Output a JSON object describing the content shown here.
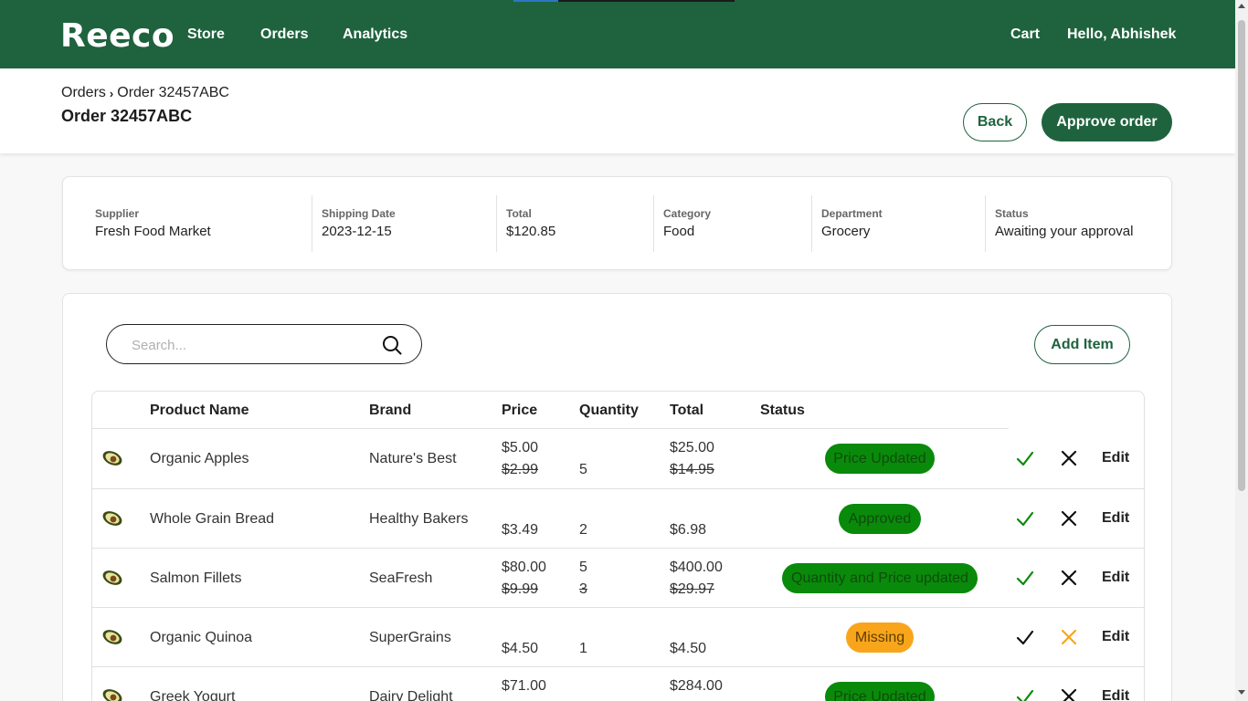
{
  "nav": {
    "logo": "Reeco",
    "links": [
      "Store",
      "Orders",
      "Analytics"
    ],
    "cart": "Cart",
    "greeting": "Hello, Abhishek"
  },
  "header": {
    "breadcrumb": [
      "Orders",
      "Order 32457ABC"
    ],
    "title": "Order 32457ABC",
    "back_label": "Back",
    "approve_label": "Approve order"
  },
  "summary": [
    {
      "label": "Supplier",
      "value": "Fresh Food Market"
    },
    {
      "label": "Shipping Date",
      "value": "2023-12-15"
    },
    {
      "label": "Total",
      "value": "$120.85"
    },
    {
      "label": "Category",
      "value": "Food"
    },
    {
      "label": "Department",
      "value": "Grocery"
    },
    {
      "label": "Status",
      "value": "Awaiting your approval"
    }
  ],
  "search": {
    "placeholder": "Search..."
  },
  "add_item_label": "Add Item",
  "table": {
    "headers": [
      "Product Name",
      "Brand",
      "Price",
      "Quantity",
      "Total",
      "Status"
    ],
    "edit_label": "Edit",
    "rows": [
      {
        "name": "Organic Apples",
        "brand": "Nature's Best",
        "price": "$5.00",
        "old_price": "$2.99",
        "qty": "5",
        "old_qty": "",
        "total": "$25.00",
        "old_total": "$14.95",
        "status": "Price Updated",
        "status_color": "green",
        "state": "approved"
      },
      {
        "name": "Whole Grain Bread",
        "brand": "Healthy Bakers",
        "price": "$3.49",
        "old_price": "",
        "qty": "2",
        "old_qty": "",
        "total": "$6.98",
        "old_total": "",
        "status": "Approved",
        "status_color": "green",
        "state": "approved"
      },
      {
        "name": "Salmon Fillets",
        "brand": "SeaFresh",
        "price": "$80.00",
        "old_price": "$9.99",
        "qty": "5",
        "old_qty": "3",
        "total": "$400.00",
        "old_total": "$29.97",
        "status": "Quantity and Price updated",
        "status_color": "green",
        "state": "approved"
      },
      {
        "name": "Organic Quinoa",
        "brand": "SuperGrains",
        "price": "$4.50",
        "old_price": "",
        "qty": "1",
        "old_qty": "",
        "total": "$4.50",
        "old_total": "",
        "status": "Missing",
        "status_color": "orange",
        "state": "missing"
      },
      {
        "name": "Greek Yogurt",
        "brand": "Dairy Delight",
        "price": "$71.00",
        "old_price": "",
        "qty": "",
        "old_qty": "",
        "total": "$284.00",
        "old_total": "",
        "status": "Price Updated",
        "status_color": "green",
        "state": "approved"
      }
    ]
  },
  "colors": {
    "brand": "#1f633e",
    "approved_check": "#0a8a0a",
    "missing_x": "#f9a51b",
    "badge_green": "#0a8a0a",
    "badge_orange": "#f9a51b"
  },
  "icons": {
    "search": "search-icon",
    "approve": "check-icon",
    "reject": "close-icon",
    "product": "avocado-icon",
    "breadcrumb_sep": "chevron-right-icon"
  }
}
